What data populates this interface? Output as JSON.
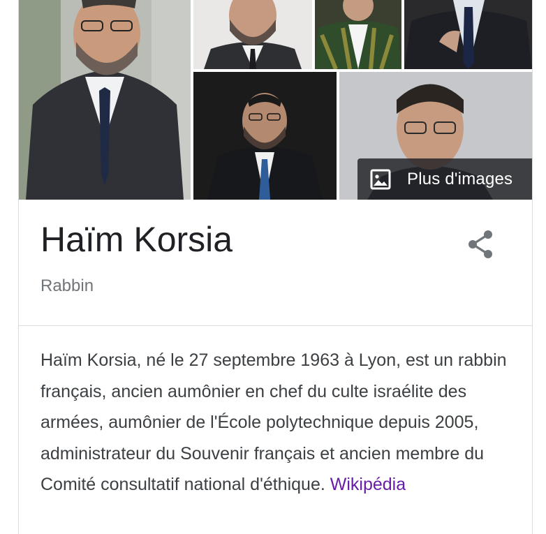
{
  "gallery": {
    "more_images_label": "Plus d'images",
    "more_images_icon": "image-icon"
  },
  "entity": {
    "name": "Haïm Korsia",
    "type": "Rabbin",
    "share_icon": "share-icon"
  },
  "description": {
    "text": "Haïm Korsia, né le 27 septembre 1963 à Lyon, est un rabbin français, ancien aumônier en chef du culte israélite des armées, aumônier de l'École polytechnique depuis 2005, administrateur du Souvenir français et ancien membre du Comité consultatif national d'éthique.",
    "source_link": "Wikipédia"
  },
  "colors": {
    "title": "#202124",
    "subtitle": "#70757a",
    "body": "#3c4043",
    "link": "#681da8",
    "divider": "#dadce0"
  }
}
